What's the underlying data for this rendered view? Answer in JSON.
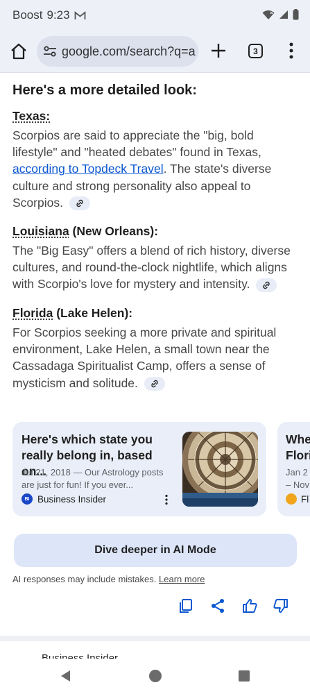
{
  "status_bar": {
    "carrier": "Boost",
    "time": "9:23",
    "icons": [
      "gmail-icon",
      "wifi-icon",
      "signal-icon",
      "battery-icon"
    ]
  },
  "toolbar": {
    "url": "google.com/search?q=a",
    "tab_count": "3",
    "icons": [
      "home-icon",
      "site-settings-icon",
      "new-tab-icon",
      "tab-switcher-icon",
      "more-vert-icon"
    ]
  },
  "content": {
    "detail_heading": "Here's a more detailed look:",
    "sections": [
      {
        "title": "Texas:",
        "text_before_link": "Scorpios are said to appreciate the \"big, bold lifestyle\" and \"heated debates\" found in Texas, ",
        "link_text": "according to Topdeck Travel",
        "text_after_link": ". The state's diverse culture and strong personality also appeal to Scorpios."
      },
      {
        "title_link": "Louisiana",
        "title_rest": " (New Orleans):",
        "text": "The \"Big Easy\" offers a blend of rich history, diverse cultures, and round-the-clock nightlife, which aligns with Scorpio's love for mystery and intensity."
      },
      {
        "title_link": "Florida",
        "title_rest": " (Lake Helen):",
        "text": "For Scorpios seeking a more private and spiritual environment, Lake Helen, a small town near the Cassadaga Spiritualist Camp, offers a sense of mysticism and solitude."
      }
    ]
  },
  "cards": [
    {
      "title": "Here's which state you really belong in, based on...",
      "snippet": "Jul 21, 2018 — Our Astrology posts are just for fun! If you ever...",
      "source": "Business Insider",
      "source_logo": "BI"
    },
    {
      "title_line1": "Whe",
      "title_line2": "Flori",
      "snippet_line1": "Jan 2",
      "snippet_line2": "– Nov",
      "source": "Fl"
    }
  ],
  "ai_mode": {
    "button_label": "Dive deeper in AI Mode",
    "disclaimer": "AI responses may include mistakes.",
    "learn_more": "Learn more"
  },
  "action_icons": [
    "copy-icon",
    "share-icon",
    "thumbs-up-icon",
    "thumbs-down-icon"
  ],
  "below_fold_text": "Business Insider",
  "colors": {
    "link": "#0b57d0",
    "card_bg": "#e9eef8",
    "ai_button_bg": "#dde5f8",
    "action_icon": "#0b57d0",
    "chrome_bg": "#eef0f8"
  }
}
